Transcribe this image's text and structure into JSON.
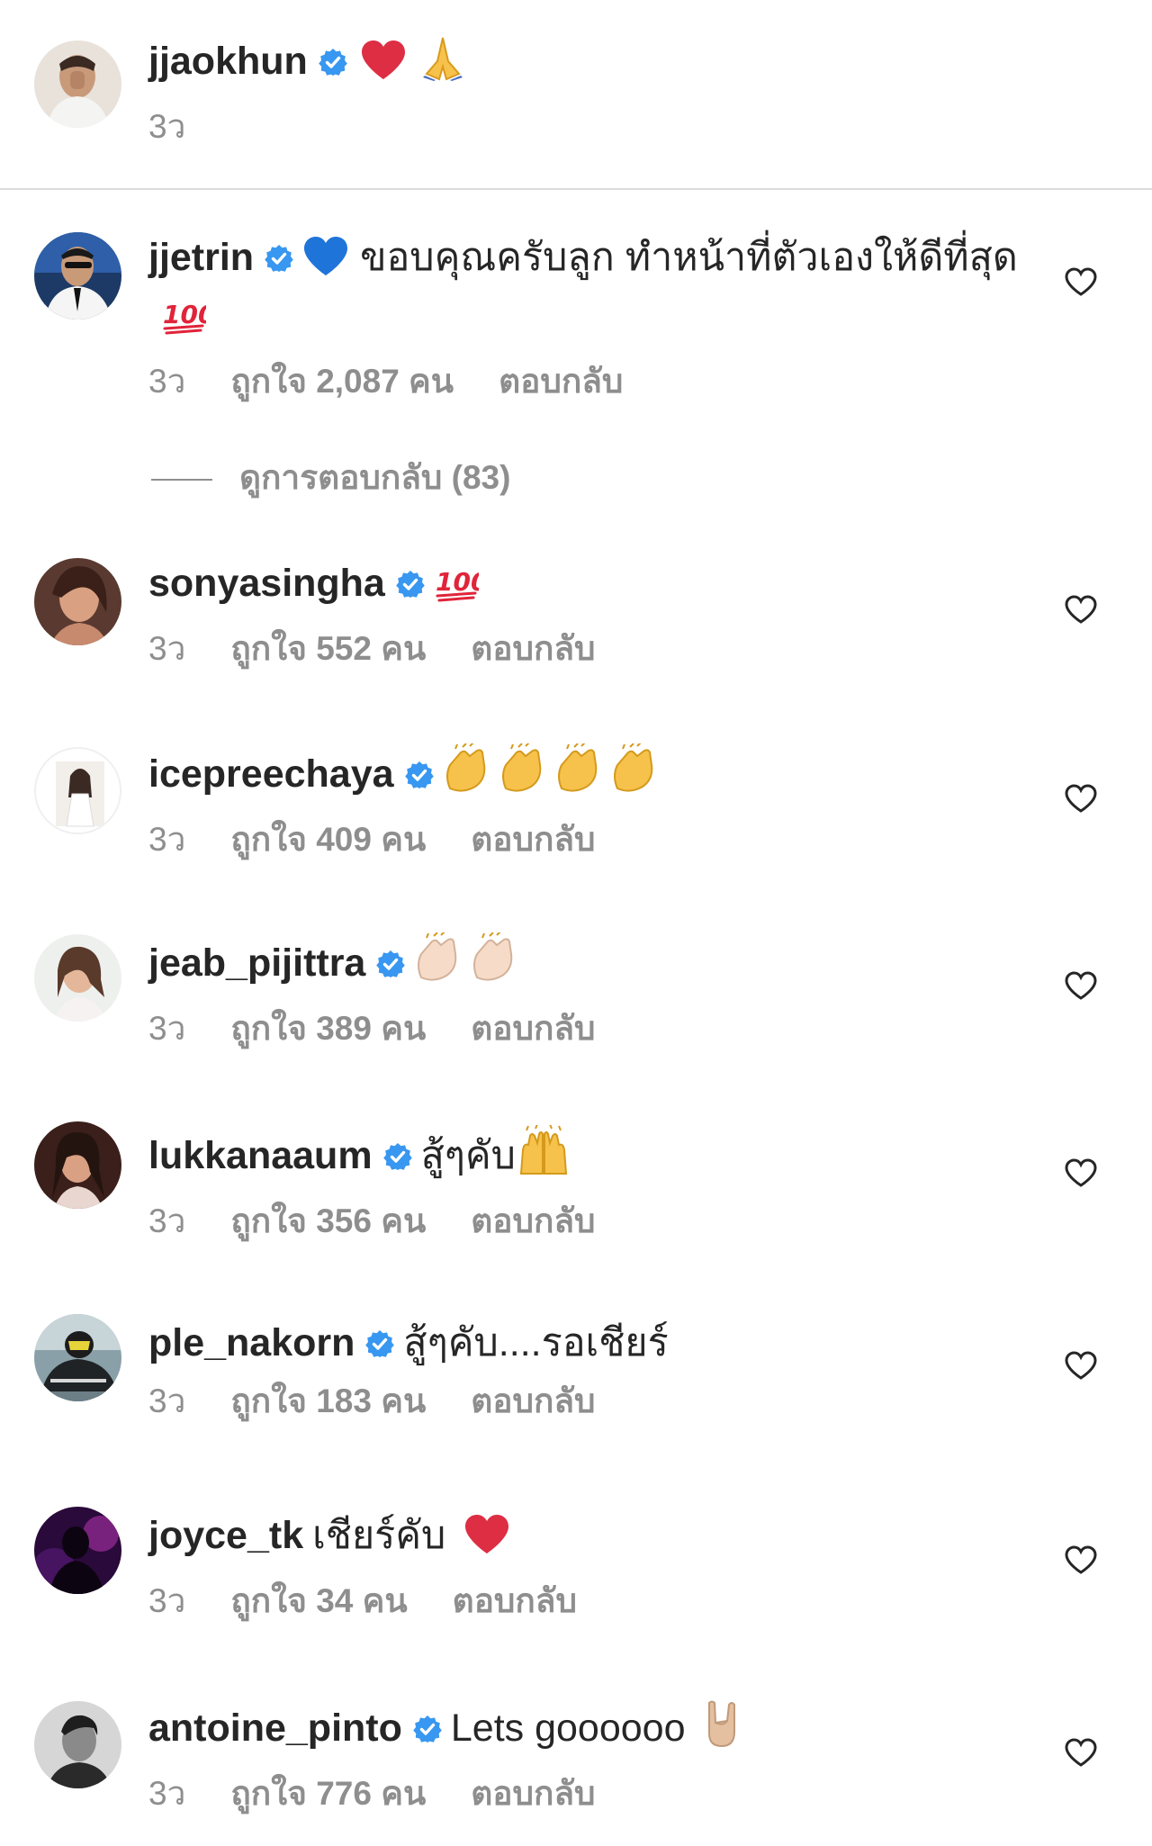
{
  "caption": {
    "username": "jjaokhun",
    "verified": true,
    "emojis": [
      "red-heart",
      "folded-hands"
    ],
    "time": "3ว"
  },
  "comments": [
    {
      "username": "jjetrin",
      "verified": true,
      "text": "ขอบคุณครับลูก ทำหน้าที่ตัวเองให้ดีที่สุด",
      "emoji_before": "blue-heart",
      "emoji_after": "hundred-points",
      "time": "3ว",
      "likes": "ถูกใจ 2,087 คน",
      "reply": "ตอบกลับ"
    },
    {
      "username": "sonyasingha",
      "verified": true,
      "text": "",
      "emoji_after": "hundred-points",
      "time": "3ว",
      "likes": "ถูกใจ 552 คน",
      "reply": "ตอบกลับ"
    },
    {
      "username": "icepreechaya",
      "verified": true,
      "text": "",
      "emoji_after": "clapping-hands x4",
      "time": "3ว",
      "likes": "ถูกใจ 409 คน",
      "reply": "ตอบกลับ"
    },
    {
      "username": "jeab_pijittra",
      "verified": true,
      "text": "",
      "emoji_after": "clapping-hands-light x2",
      "time": "3ว",
      "likes": "ถูกใจ 389 คน",
      "reply": "ตอบกลับ"
    },
    {
      "username": "lukkanaaum",
      "verified": true,
      "text": "สู้ๆคับ",
      "emoji_after": "raising-hands",
      "time": "3ว",
      "likes": "ถูกใจ 356 คน",
      "reply": "ตอบกลับ"
    },
    {
      "username": "ple_nakorn",
      "verified": true,
      "text": "สู้ๆคับ....รอเชียร์",
      "time": "3ว",
      "likes": "ถูกใจ 183 คน",
      "reply": "ตอบกลับ"
    },
    {
      "username": "joyce_tk",
      "verified": false,
      "text": "เชียร์คับ",
      "emoji_after": "red-heart",
      "time": "3ว",
      "likes": "ถูกใจ 34 คน",
      "reply": "ตอบกลับ"
    },
    {
      "username": "antoine_pinto",
      "verified": true,
      "text": "Lets goooooo",
      "emoji_after": "sign-of-the-horns",
      "time": "3ว",
      "likes": "ถูกใจ 776 คน",
      "reply": "ตอบกลับ"
    }
  ],
  "view_replies": "ดูการตอบกลับ (83)",
  "colors": {
    "verified": "#3897f0",
    "text": "#262626",
    "secondary": "#8e8e8e",
    "divider": "#dbdbdb"
  },
  "icons": [
    "verified-badge-icon",
    "heart-outline-icon"
  ]
}
